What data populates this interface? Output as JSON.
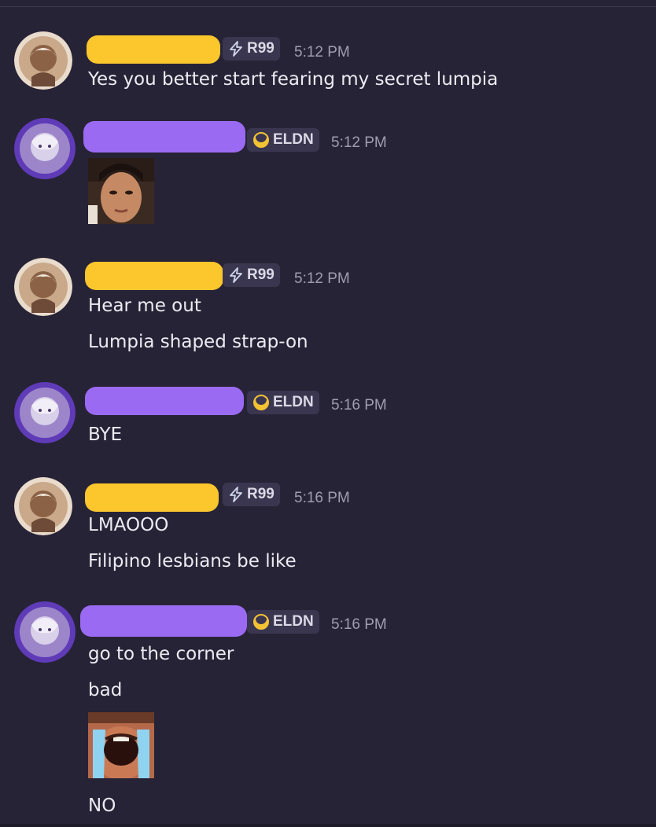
{
  "messages": [
    {
      "author_color": "#fcc72d",
      "tag": "R99",
      "tag_icon": "lightning-icon",
      "time": "5:12 PM",
      "lines": [
        "Yes you better start fearing my secret lumpia"
      ]
    },
    {
      "author_color": "#9a6af3",
      "tag": "ELDN",
      "tag_icon": "crescent-icon",
      "time": "5:12 PM",
      "image": "reaction-image-woman-face"
    },
    {
      "author_color": "#fcc72d",
      "tag": "R99",
      "tag_icon": "lightning-icon",
      "time": "5:12 PM",
      "lines": [
        "Hear me out",
        "Lumpia shaped strap-on"
      ]
    },
    {
      "author_color": "#9a6af3",
      "tag": "ELDN",
      "tag_icon": "crescent-icon",
      "time": "5:16 PM",
      "lines": [
        "BYE"
      ]
    },
    {
      "author_color": "#fcc72d",
      "tag": "R99",
      "tag_icon": "lightning-icon",
      "time": "5:16 PM",
      "lines": [
        "LMAOOO",
        "Filipino lesbians be like"
      ]
    },
    {
      "author_color": "#9a6af3",
      "tag": "ELDN",
      "tag_icon": "crescent-icon",
      "time": "5:16 PM",
      "lines": [
        "go to the corner",
        "bad",
        "NO"
      ],
      "image": "reaction-image-crying-man"
    }
  ]
}
